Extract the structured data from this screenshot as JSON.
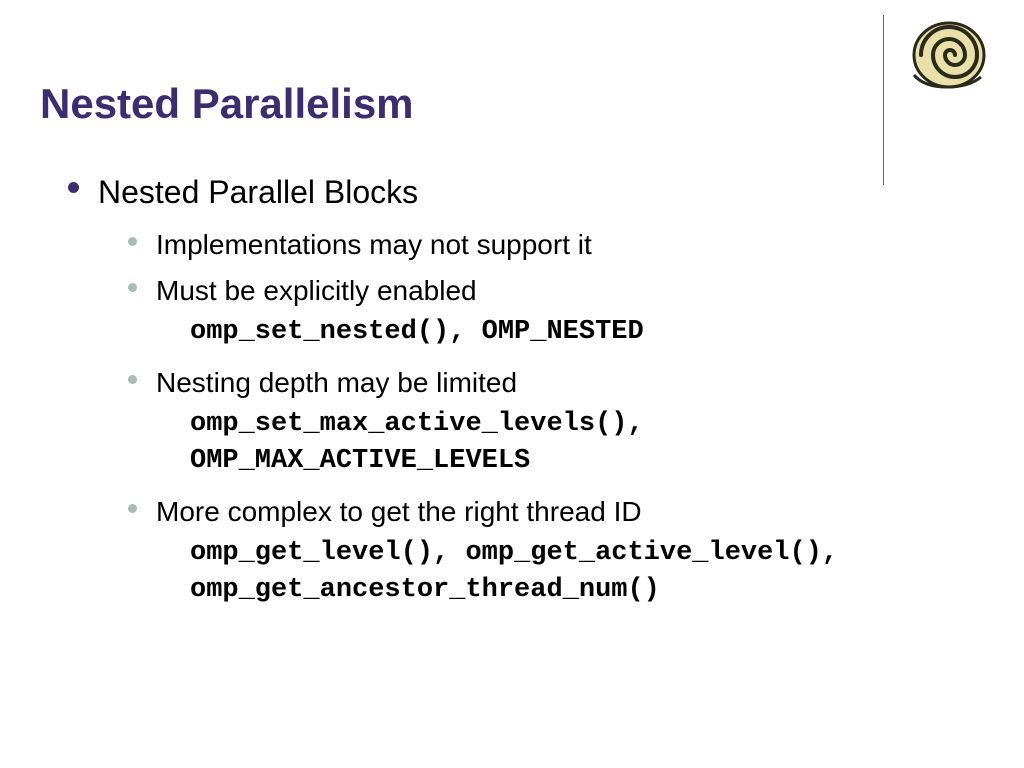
{
  "title": "Nested Parallelism",
  "bullet1": "Nested Parallel Blocks",
  "sub1": "Implementations may not support it",
  "sub2": "Must be explicitly enabled",
  "code2a": "omp_set_nested()",
  "code2b": "OMP_NESTED",
  "sub3": "Nesting depth may be limited",
  "code3a": "omp_set_max_active_levels()",
  "code3b": "OMP_MAX_ACTIVE_LEVELS",
  "sub4": "More complex to get the right thread ID",
  "code4a": "omp_get_level()",
  "code4b": "omp_get_active_level()",
  "code4c": "omp_get_ancestor_thread_num()"
}
